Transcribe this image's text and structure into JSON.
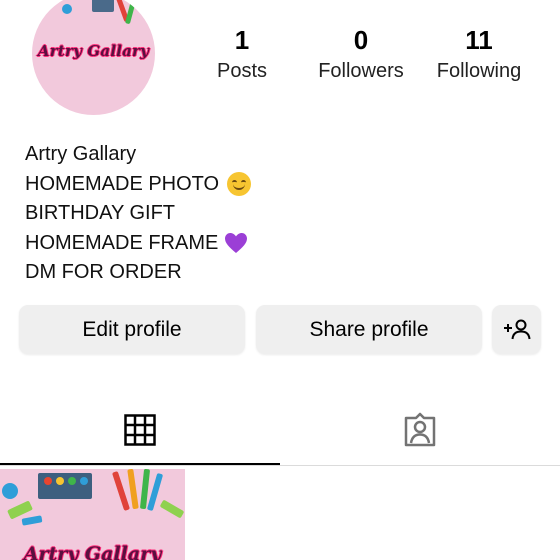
{
  "profile": {
    "avatar_text": "Artry Gallary",
    "stats": [
      {
        "value": "1",
        "label": "Posts"
      },
      {
        "value": "0",
        "label": "Followers"
      },
      {
        "value": "11",
        "label": "Following"
      }
    ],
    "bio": [
      "Artry Gallary",
      "HOMEMADE PHOTO",
      "BIRTHDAY GIFT",
      "HOMEMADE FRAME",
      "DM FOR ORDER"
    ]
  },
  "actions": {
    "edit_label": "Edit profile",
    "share_label": "Share profile",
    "add_person_icon": "add-person-icon"
  },
  "tabs": [
    {
      "icon": "grid-icon",
      "active": true
    },
    {
      "icon": "tagged-person-icon",
      "active": false
    }
  ],
  "posts": [
    {
      "overlay_text": "Artry Gallary"
    }
  ],
  "colors": {
    "button_bg": "#efefef",
    "thumb_bg": "#f2c9dc",
    "text_accent": "#ff2d7a",
    "heart": "#9b3fd6",
    "smile": "#f7c531"
  }
}
